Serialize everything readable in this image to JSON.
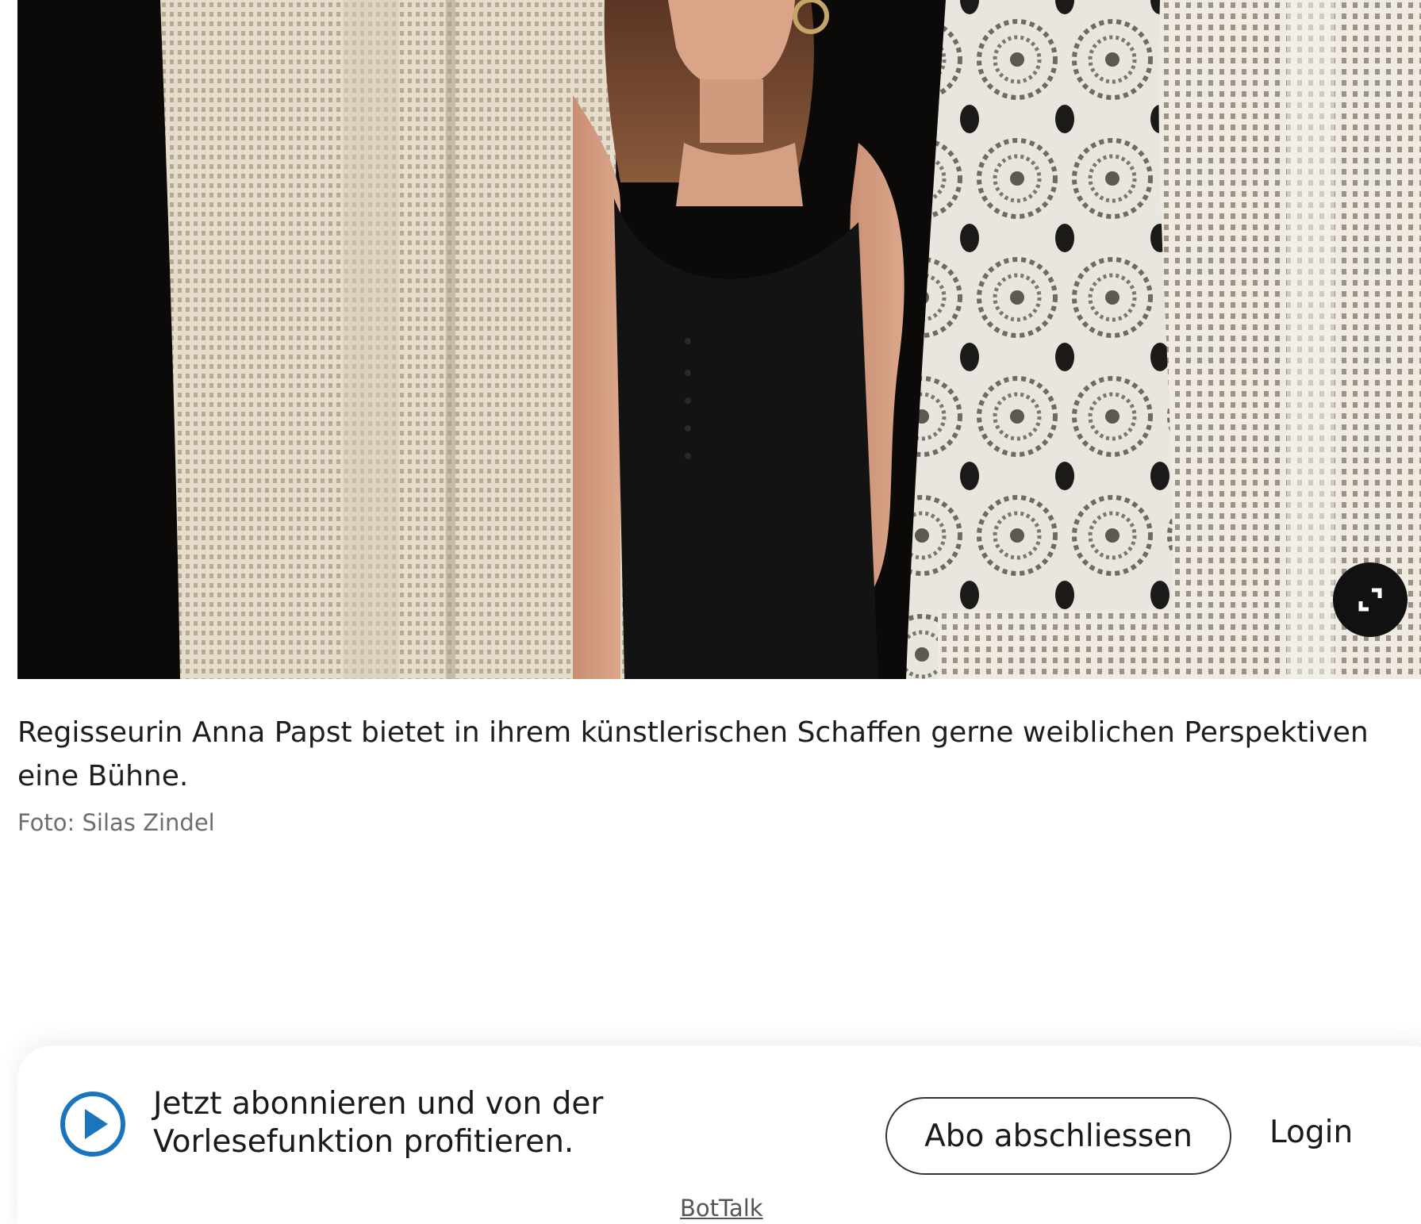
{
  "image": {
    "expand_icon": "expand-icon"
  },
  "caption": {
    "text": "Regisseurin Anna Papst bietet in ihrem künstlerischen Schaffen gerne weiblichen Perspektiven eine Bühne.",
    "credit": "Foto: Silas Zindel"
  },
  "promo": {
    "play_icon": "play-circle-icon",
    "text": "Jetzt abonnieren und von der Vorlesefunktion profitieren.",
    "subscribe_label": "Abo abschliessen",
    "login_label": "Login",
    "provider_label": "BotTalk"
  },
  "colors": {
    "accent_blue": "#1a75bc",
    "button_border": "#333333",
    "credit_gray": "#6e6e6e"
  }
}
